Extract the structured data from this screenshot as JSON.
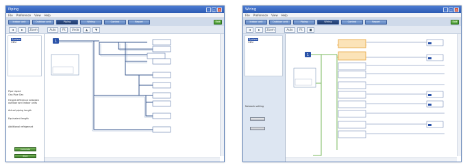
{
  "window1": {
    "title": "Piping",
    "menu": [
      "File",
      "Preference",
      "View",
      "Help"
    ],
    "tabs": [
      "Indoor unit",
      "Outdoor unit",
      "Piping",
      "Wiring",
      "Control",
      "Report"
    ],
    "active_tab": "Piping",
    "close_label": "Exit",
    "toolbar": [
      "◄",
      "►",
      "Zoom",
      "",
      "Auto",
      "Fit",
      "Undo",
      "▲",
      "▼"
    ],
    "tree": [
      "System",
      "ODU"
    ],
    "properties": [
      "Pipe     Liquid",
      "Gas Pipe    Gas",
      "Height difference between",
      "outdoor and indoor units",
      "Actual piping length",
      "Equivalent length",
      "Additional refrigerant"
    ],
    "buttons": [
      "Calculate",
      "Print"
    ]
  },
  "window2": {
    "title": "Wiring",
    "menu": [
      "File",
      "Preference",
      "View",
      "Help"
    ],
    "tabs": [
      "Indoor unit",
      "Outdoor unit",
      "Piping",
      "Wiring",
      "Control",
      "Report"
    ],
    "active_tab": "Wiring",
    "close_label": "Exit",
    "toolbar": [
      "◄",
      "►",
      "Zoom",
      "Auto",
      "Fit",
      "■"
    ],
    "tree": [
      "System",
      "ODU"
    ],
    "panel_title": "Network setting",
    "panel_buttons": [
      "",
      ""
    ]
  },
  "colors": {
    "title_bar": "#2c5bb4",
    "tab": "#5c82c0",
    "tab_active": "#1f3b6e",
    "pipe": "#35558c",
    "wire_green": "#7ab85c",
    "wire_orange": "#e7a33c"
  }
}
